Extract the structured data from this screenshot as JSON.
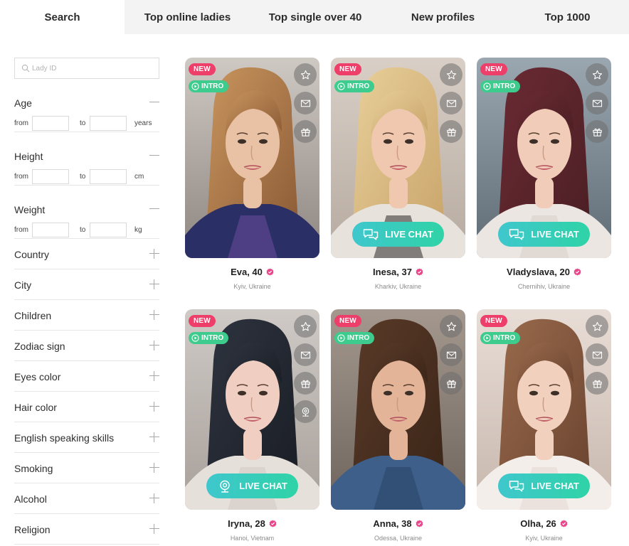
{
  "tabs": [
    {
      "label": "Search",
      "active": true
    },
    {
      "label": "Top online ladies",
      "active": false
    },
    {
      "label": "Top single over 40",
      "active": false
    },
    {
      "label": "New profiles",
      "active": false
    },
    {
      "label": "Top 1000",
      "active": false
    }
  ],
  "sidebar": {
    "search_placeholder": "Lady ID",
    "range_filters": [
      {
        "label": "Age",
        "from_label": "from",
        "to_label": "to",
        "unit": "years"
      },
      {
        "label": "Height",
        "from_label": "from",
        "to_label": "to",
        "unit": "cm"
      },
      {
        "label": "Weight",
        "from_label": "from",
        "to_label": "to",
        "unit": "kg"
      }
    ],
    "filters": [
      "Country",
      "City",
      "Children",
      "Zodiac sign",
      "Eyes color",
      "Hair color",
      "English speaking skills",
      "Smoking",
      "Alcohol",
      "Religion"
    ]
  },
  "cards": [
    {
      "name": "Eva, 40",
      "location": "Kyiv, Ukraine",
      "badge_new": "NEW",
      "badge_intro": "INTRO",
      "live_chat": null,
      "live_chat_icon": null,
      "has_webcam": false
    },
    {
      "name": "Inesa, 37",
      "location": "Kharkiv, Ukraine",
      "badge_new": "NEW",
      "badge_intro": "INTRO",
      "live_chat": "LIVE CHAT",
      "live_chat_icon": "chat-bubbles-icon",
      "has_webcam": false
    },
    {
      "name": "Vladyslava, 20",
      "location": "Chernihiv, Ukraine",
      "badge_new": "NEW",
      "badge_intro": "INTRO",
      "live_chat": "LIVE CHAT",
      "live_chat_icon": "chat-bubbles-icon",
      "has_webcam": false
    },
    {
      "name": "Iryna, 28",
      "location": "Hanoi, Vietnam",
      "badge_new": "NEW",
      "badge_intro": "INTRO",
      "live_chat": "LIVE CHAT",
      "live_chat_icon": "webcam-icon",
      "has_webcam": true
    },
    {
      "name": "Anna, 38",
      "location": "Odessa, Ukraine",
      "badge_new": "NEW",
      "badge_intro": "INTRO",
      "live_chat": null,
      "live_chat_icon": null,
      "has_webcam": false
    },
    {
      "name": "Olha, 26",
      "location": "Kyiv, Ukraine",
      "badge_new": "NEW",
      "badge_intro": "INTRO",
      "live_chat": "LIVE CHAT",
      "live_chat_icon": "chat-bubbles-icon",
      "has_webcam": false
    }
  ],
  "colors": {
    "new_badge": "#ee3e6a",
    "intro_badge": "#3dcc8d",
    "live_chat_gradient_start": "#3fc7cd",
    "live_chat_gradient_end": "#2fd3a7",
    "verified": "#e8458b",
    "tab_bar_bg": "#f3f3f3"
  }
}
